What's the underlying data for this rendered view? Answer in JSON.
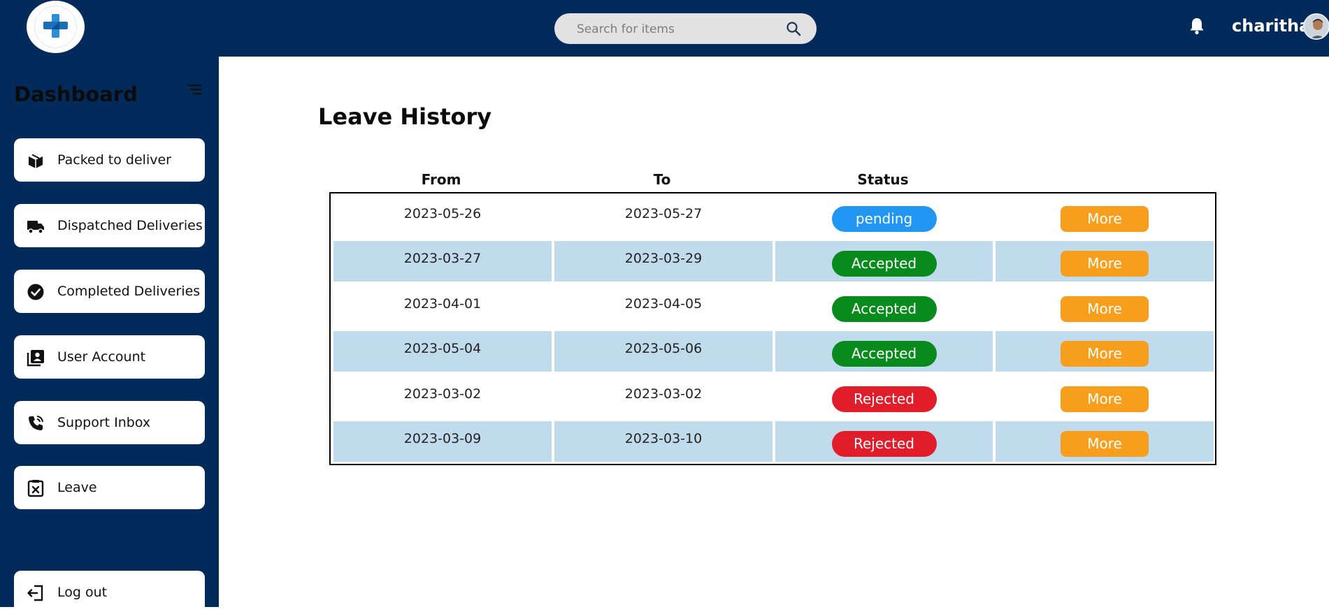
{
  "header": {
    "search_placeholder": "Search for items",
    "username": "charitha",
    "logo_alt": "OMNIPHARMA"
  },
  "sidebar": {
    "title": "Dashboard",
    "items": [
      {
        "label": "Packed to deliver",
        "icon": "package-icon"
      },
      {
        "label": "Dispatched Deliveries",
        "icon": "truck-icon"
      },
      {
        "label": "Completed Deliveries",
        "icon": "check-circle-icon"
      },
      {
        "label": "User Account",
        "icon": "user-account-icon"
      },
      {
        "label": "Support Inbox",
        "icon": "phone-icon"
      },
      {
        "label": "Leave",
        "icon": "calendar-x-icon"
      }
    ],
    "logout_label": "Log out"
  },
  "main": {
    "title": "Leave History",
    "columns": [
      "From",
      "To",
      "Status"
    ],
    "rows": [
      {
        "from": "2023-05-26",
        "to": "2023-05-27",
        "status": "pending",
        "action": "More"
      },
      {
        "from": "2023-03-27",
        "to": "2023-03-29",
        "status": "Accepted",
        "action": "More"
      },
      {
        "from": "2023-04-01",
        "to": "2023-04-05",
        "status": "Accepted",
        "action": "More"
      },
      {
        "from": "2023-05-04",
        "to": "2023-05-06",
        "status": "Accepted",
        "action": "More"
      },
      {
        "from": "2023-03-02",
        "to": "2023-03-02",
        "status": "Rejected",
        "action": "More"
      },
      {
        "from": "2023-03-09",
        "to": "2023-03-10",
        "status": "Rejected",
        "action": "More"
      }
    ]
  },
  "colors": {
    "navy": "#022b5c",
    "pending": "#2196f3",
    "accepted": "#088a1c",
    "rejected": "#e11d2a",
    "more": "#f79f1c",
    "row_shade": "#c0dbec"
  }
}
